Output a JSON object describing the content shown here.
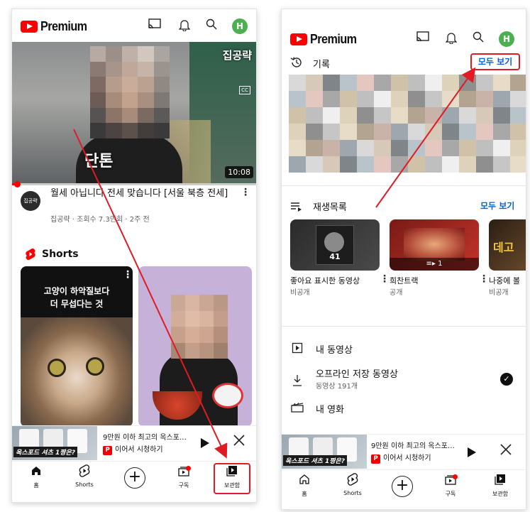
{
  "brand": {
    "name": "Premium",
    "avatar_letter": "H",
    "accent": "#ff0000",
    "link_color": "#065fd4",
    "annotation_color": "#e01b24"
  },
  "header_icons": [
    "cast-icon",
    "bell-icon",
    "search-icon",
    "avatar"
  ],
  "left": {
    "video": {
      "overlay_channel": "집공략",
      "overlay_caption": "단톤",
      "duration": "10:08",
      "title": "월세 아닙니다 전세 맞습니다 [서울 북층 전세]",
      "channel": "집공략",
      "meta": "집공략 · 조회수 7.3만회 · 2주 전",
      "channel_avatar_text": "집공략",
      "progress": 0.02
    },
    "shorts": {
      "label": "Shorts",
      "items": [
        {
          "caption": "고양이 하악질보다\n더 무섭다는 것"
        },
        {
          "caption": ""
        }
      ]
    },
    "mini_player": {
      "title": "9만원 이하 최고의 옥스포…",
      "subtitle": "이어서 시청하기",
      "thumb_text": "옥스포드 셔츠 1짱은?"
    },
    "nav": [
      {
        "label": "홈",
        "icon": "home-icon"
      },
      {
        "label": "Shorts",
        "icon": "shorts-icon"
      },
      {
        "label": "",
        "icon": "create-icon"
      },
      {
        "label": "구독",
        "icon": "subscriptions-icon"
      },
      {
        "label": "보관함",
        "icon": "library-icon"
      }
    ]
  },
  "right": {
    "history": {
      "label": "기록",
      "see_all": "모두 보기"
    },
    "playlists": {
      "label": "재생목록",
      "see_all": "모두 보기",
      "items": [
        {
          "title": "좋아요 표시한 동영상",
          "sub": "비공개",
          "count": "41"
        },
        {
          "title": "희찬트랙",
          "sub": "공개",
          "count": "1"
        },
        {
          "title": "나중에 볼",
          "sub": "비공개",
          "count": ""
        }
      ]
    },
    "rows": [
      {
        "label": "내 동영상",
        "sub": ""
      },
      {
        "label": "오프라인 저장 동영상",
        "sub": "동영상 191개"
      },
      {
        "label": "내 영화",
        "sub": ""
      }
    ],
    "mini_player": {
      "title": "9만원 이하 최고의 옥스포…",
      "subtitle": "이어서 시청하기",
      "thumb_text": "옥스포드 셔츠 1짱은?"
    },
    "nav": [
      {
        "label": "홈"
      },
      {
        "label": "Shorts"
      },
      {
        "label": ""
      },
      {
        "label": "구독"
      },
      {
        "label": "보관함"
      }
    ]
  }
}
